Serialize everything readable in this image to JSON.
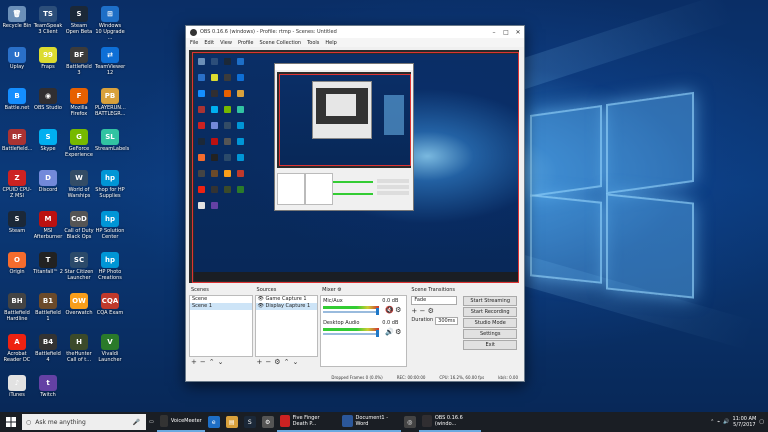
{
  "desktop": {
    "icons": [
      {
        "label": "Recycle Bin",
        "glyph": "🗑",
        "color": "#6b8fb8"
      },
      {
        "label": "TeamSpeak 3 Client",
        "glyph": "TS",
        "color": "#2c4e7a"
      },
      {
        "label": "Steam Open Beta",
        "glyph": "S",
        "color": "#1b2838"
      },
      {
        "label": "Windows 10 Upgrade ...",
        "glyph": "⊞",
        "color": "#1e6fc7"
      },
      {
        "label": "Uplay",
        "glyph": "U",
        "color": "#2a70c8"
      },
      {
        "label": "Fraps",
        "glyph": "99",
        "color": "#dcdc30"
      },
      {
        "label": "Battlefield 3",
        "glyph": "BF",
        "color": "#3b3b3b"
      },
      {
        "label": "TeamViewer 12",
        "glyph": "⇄",
        "color": "#0e6fd6"
      },
      {
        "label": "Battle.net",
        "glyph": "B",
        "color": "#148eff"
      },
      {
        "label": "OBS Studio",
        "glyph": "◉",
        "color": "#302e31"
      },
      {
        "label": "Mozilla Firefox",
        "glyph": "F",
        "color": "#e66000"
      },
      {
        "label": "PLAYERUN... BATTLEGR...",
        "glyph": "PB",
        "color": "#d9a13c"
      },
      {
        "label": "Battlefield...",
        "glyph": "BF",
        "color": "#a33"
      },
      {
        "label": "Skype",
        "glyph": "S",
        "color": "#00aff0"
      },
      {
        "label": "GeForce Experience",
        "glyph": "G",
        "color": "#76b900"
      },
      {
        "label": "StreamLabels",
        "glyph": "SL",
        "color": "#31c3a2"
      },
      {
        "label": "CPUID CPU-Z MSI",
        "glyph": "Z",
        "color": "#c22"
      },
      {
        "label": "Discord",
        "glyph": "D",
        "color": "#7289da"
      },
      {
        "label": "World of Warships",
        "glyph": "W",
        "color": "#334c66"
      },
      {
        "label": "Shop for HP Supplies",
        "glyph": "hp",
        "color": "#0096d6"
      },
      {
        "label": "Steam",
        "glyph": "S",
        "color": "#1b2838"
      },
      {
        "label": "MSI Afterburner",
        "glyph": "M",
        "color": "#b11"
      },
      {
        "label": "Call of Duty Black Ops",
        "glyph": "CoD",
        "color": "#555"
      },
      {
        "label": "HP Solution Center",
        "glyph": "hp",
        "color": "#0096d6"
      },
      {
        "label": "Origin",
        "glyph": "O",
        "color": "#f56c2d"
      },
      {
        "label": "Titanfall™ 2",
        "glyph": "T",
        "color": "#222"
      },
      {
        "label": "Star Citizen Launcher",
        "glyph": "SC",
        "color": "#2b4a6a"
      },
      {
        "label": "HP Photo Creations",
        "glyph": "hp",
        "color": "#0096d6"
      },
      {
        "label": "Battlefield Hardline",
        "glyph": "BH",
        "color": "#444"
      },
      {
        "label": "Battlefield 1",
        "glyph": "B1",
        "color": "#6b4a2a"
      },
      {
        "label": "Overwatch",
        "glyph": "OW",
        "color": "#f99e1a"
      },
      {
        "label": "CQA Exam",
        "glyph": "CQA",
        "color": "#c0392b"
      },
      {
        "label": "Acrobat Reader DC",
        "glyph": "A",
        "color": "#e21"
      },
      {
        "label": "Battlefield 4",
        "glyph": "B4",
        "color": "#333"
      },
      {
        "label": "theHunter Call of t...",
        "glyph": "H",
        "color": "#3b4a2a"
      },
      {
        "label": "Vivaldi Launcher",
        "glyph": "V",
        "color": "#2a7a2a"
      },
      {
        "label": "iTunes",
        "glyph": "♪",
        "color": "#e2e2e2"
      },
      {
        "label": "Twitch",
        "glyph": "t",
        "color": "#6441a4"
      }
    ]
  },
  "obs": {
    "title": "OBS 0.16.6 (windows) - Profile: rtmp - Scenes: Untitled",
    "menu": [
      "File",
      "Edit",
      "View",
      "Profile",
      "Scene Collection",
      "Tools",
      "Help"
    ],
    "scenes": {
      "header": "Scenes",
      "items": [
        "Scene",
        "Scene 1"
      ]
    },
    "sources": {
      "header": "Sources",
      "items": [
        "Game Capture 1",
        "Display Capture 1"
      ]
    },
    "mixer": {
      "header": "Mixer",
      "tracks": [
        {
          "name": "Mic/Aux",
          "db": "0.0 dB"
        },
        {
          "name": "Desktop Audio",
          "db": "0.0 dB"
        }
      ]
    },
    "transitions": {
      "header": "Scene Transitions",
      "selected": "Fade",
      "duration_label": "Duration",
      "duration": "300ms"
    },
    "controls": [
      "Start Streaming",
      "Start Recording",
      "Studio Mode",
      "Settings",
      "Exit"
    ],
    "status": {
      "dropped": "Dropped Frames 0 (0.0%)",
      "rec": "REC: 00:00:00",
      "cpu": "CPU: 16.2%, 60.00 fps",
      "kbps": "kb/s: 0.00"
    }
  },
  "taskbar": {
    "search_placeholder": "Ask me anything",
    "items": [
      {
        "label": "VoiceMeeter",
        "color": "#333"
      },
      {
        "label": "",
        "color": "#1e6fc7",
        "glyph": "e"
      },
      {
        "label": "",
        "color": "#d9a13c",
        "glyph": "▤"
      },
      {
        "label": "",
        "color": "#1b2838",
        "glyph": "S"
      },
      {
        "label": "",
        "color": "#555",
        "glyph": "⚙"
      },
      {
        "label": "Five Finger Death P...",
        "color": "#c22"
      },
      {
        "label": "Document1 - Word",
        "color": "#2b579a"
      },
      {
        "label": "",
        "color": "#444",
        "glyph": "◎"
      },
      {
        "label": "OBS 0.16.6 (windo...",
        "color": "#302e31"
      }
    ],
    "clock_time": "11:00 AM",
    "clock_date": "5/7/2017"
  },
  "colors": {
    "accent": "#1e78c8",
    "selection": "#cde4f7"
  }
}
